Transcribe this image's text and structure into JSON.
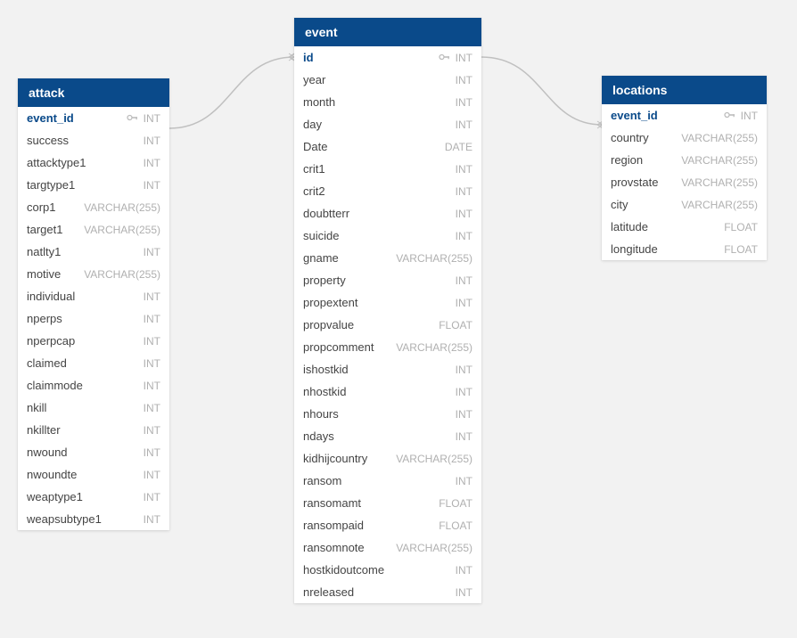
{
  "tables": [
    {
      "id": "attack",
      "title": "attack",
      "columns": [
        {
          "name": "event_id",
          "type": "INT",
          "key": true
        },
        {
          "name": "success",
          "type": "INT"
        },
        {
          "name": "attacktype1",
          "type": "INT"
        },
        {
          "name": "targtype1",
          "type": "INT"
        },
        {
          "name": "corp1",
          "type": "VARCHAR(255)"
        },
        {
          "name": "target1",
          "type": "VARCHAR(255)"
        },
        {
          "name": "natlty1",
          "type": "INT"
        },
        {
          "name": "motive",
          "type": "VARCHAR(255)"
        },
        {
          "name": "individual",
          "type": "INT"
        },
        {
          "name": "nperps",
          "type": "INT"
        },
        {
          "name": "nperpcap",
          "type": "INT"
        },
        {
          "name": "claimed",
          "type": "INT"
        },
        {
          "name": "claimmode",
          "type": "INT"
        },
        {
          "name": "nkill",
          "type": "INT"
        },
        {
          "name": "nkillter",
          "type": "INT"
        },
        {
          "name": "nwound",
          "type": "INT"
        },
        {
          "name": "nwoundte",
          "type": "INT"
        },
        {
          "name": "weaptype1",
          "type": "INT"
        },
        {
          "name": "weapsubtype1",
          "type": "INT"
        }
      ]
    },
    {
      "id": "event",
      "title": "event",
      "columns": [
        {
          "name": "id",
          "type": "INT",
          "key": true
        },
        {
          "name": "year",
          "type": "INT"
        },
        {
          "name": "month",
          "type": "INT"
        },
        {
          "name": "day",
          "type": "INT"
        },
        {
          "name": "Date",
          "type": "DATE"
        },
        {
          "name": "crit1",
          "type": "INT"
        },
        {
          "name": "crit2",
          "type": "INT"
        },
        {
          "name": "doubtterr",
          "type": "INT"
        },
        {
          "name": "suicide",
          "type": "INT"
        },
        {
          "name": "gname",
          "type": "VARCHAR(255)"
        },
        {
          "name": "property",
          "type": "INT"
        },
        {
          "name": "propextent",
          "type": "INT"
        },
        {
          "name": "propvalue",
          "type": "FLOAT"
        },
        {
          "name": "propcomment",
          "type": "VARCHAR(255)"
        },
        {
          "name": "ishostkid",
          "type": "INT"
        },
        {
          "name": "nhostkid",
          "type": "INT"
        },
        {
          "name": "nhours",
          "type": "INT"
        },
        {
          "name": "ndays",
          "type": "INT"
        },
        {
          "name": "kidhijcountry",
          "type": "VARCHAR(255)"
        },
        {
          "name": "ransom",
          "type": "INT"
        },
        {
          "name": "ransomamt",
          "type": "FLOAT"
        },
        {
          "name": "ransompaid",
          "type": "FLOAT"
        },
        {
          "name": "ransomnote",
          "type": "VARCHAR(255)"
        },
        {
          "name": "hostkidoutcome",
          "type": "INT"
        },
        {
          "name": "nreleased",
          "type": "INT"
        }
      ]
    },
    {
      "id": "locations",
      "title": "locations",
      "columns": [
        {
          "name": "event_id",
          "type": "INT",
          "key": true
        },
        {
          "name": "country",
          "type": "VARCHAR(255)"
        },
        {
          "name": "region",
          "type": "VARCHAR(255)"
        },
        {
          "name": "provstate",
          "type": "VARCHAR(255)"
        },
        {
          "name": "city",
          "type": "VARCHAR(255)"
        },
        {
          "name": "latitude",
          "type": "FLOAT"
        },
        {
          "name": "longitude",
          "type": "FLOAT"
        }
      ]
    }
  ],
  "relationships": [
    {
      "from": "attack.event_id",
      "to": "event.id"
    },
    {
      "from": "locations.event_id",
      "to": "event.id"
    }
  ]
}
